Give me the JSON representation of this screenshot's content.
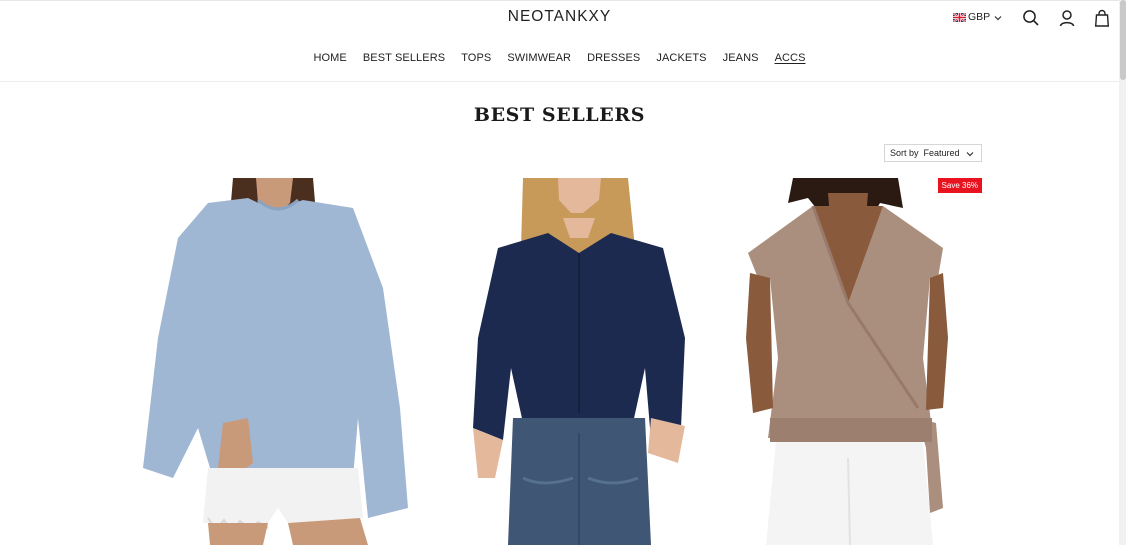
{
  "header": {
    "logo": "NEOTANKXY",
    "currency": "GBP",
    "currency_flag_icon": "uk-flag-icon"
  },
  "icons": {
    "search": "search-icon",
    "account": "user-icon",
    "cart": "bag-icon"
  },
  "nav": {
    "items": [
      {
        "label": "HOME",
        "active": false
      },
      {
        "label": "BEST SELLERS",
        "active": false
      },
      {
        "label": "TOPS",
        "active": false
      },
      {
        "label": "SWIMWEAR",
        "active": false
      },
      {
        "label": "DRESSES",
        "active": false
      },
      {
        "label": "JACKETS",
        "active": false
      },
      {
        "label": "JEANS",
        "active": false
      },
      {
        "label": "ACCS",
        "active": true
      }
    ]
  },
  "collection": {
    "title": "BEST SELLERS",
    "sort_label": "Sort by",
    "sort_value": "Featured"
  },
  "products": [
    {
      "badge": "",
      "colors": {
        "top": "#9fb7d3",
        "bottom": "#f2f2f2",
        "skin": "#c99a7a",
        "hair": "#4a2e1e"
      }
    },
    {
      "badge": "",
      "colors": {
        "top": "#1c2a4f",
        "bottom": "#3f5674",
        "skin": "#e3b89b",
        "hair": "#c79a5a"
      }
    },
    {
      "badge": "Save 36%",
      "colors": {
        "top": "#ab8f7e",
        "bottom": "#f4f4f4",
        "skin": "#8a5a3c",
        "hair": "#2a1a12"
      }
    }
  ],
  "theme": {
    "badge_color": "#e8131f",
    "text_color": "#222222"
  }
}
